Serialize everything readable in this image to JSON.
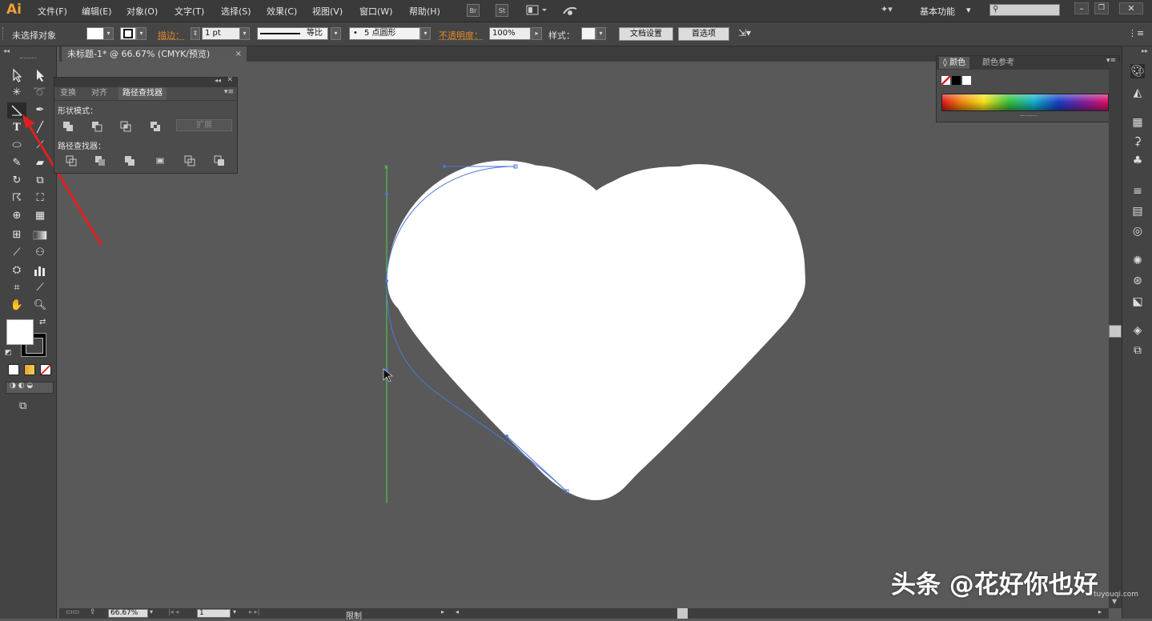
{
  "app": {
    "logo": "Ai"
  },
  "menu": {
    "items": [
      "文件(F)",
      "编辑(E)",
      "对象(O)",
      "文字(T)",
      "选择(S)",
      "效果(C)",
      "视图(V)",
      "窗口(W)",
      "帮助(H)"
    ],
    "bridge_label": "Br",
    "stock_label": "St",
    "workspace": "基本功能",
    "search_placeholder": ""
  },
  "control_bar": {
    "selection_status": "未选择对象",
    "stroke_label": "描边：",
    "stroke_weight": "1 pt",
    "stroke_profile": "等比",
    "brush": "5 点圆形",
    "opacity_label": "不透明度：",
    "opacity_value": "100%",
    "style_label": "样式：",
    "doc_setup_button": "文档设置",
    "preferences_button": "首选项"
  },
  "document": {
    "tab_title": "未标题-1* @ 66.67% (CMYK/预览)",
    "tab_close": "×"
  },
  "pathfinder_panel": {
    "tabs": [
      "变换",
      "对齐",
      "路径查找器"
    ],
    "active_tab": "路径查找器",
    "shape_modes_label": "形状模式：",
    "pathfinders_label": "路径查找器：",
    "expand_button": "扩展"
  },
  "color_panel": {
    "tabs": [
      "颜色",
      "颜色参考"
    ],
    "active_tab": "颜色"
  },
  "status_bar": {
    "zoom": "66.67%",
    "artboard_number": "1",
    "status_text": "限制"
  },
  "watermark": {
    "main": "头条 @花好你也好",
    "sub": "tuyouqi.com"
  },
  "colors": {
    "fill_swatch": "#ffffff",
    "stroke_swatch": "#000000",
    "accent_orange": "#e08a2a",
    "guide_green": "#4fd24f",
    "path_blue": "#4a78d8",
    "arrow_red": "#e02020"
  },
  "icons": {
    "tools": [
      "selection-tool",
      "direct-selection-tool",
      "magic-wand-tool",
      "lasso-tool",
      "line-segment-tool",
      "pen-tool",
      "type-tool",
      "line-tool",
      "ellipse-tool",
      "brush-tool",
      "pencil-tool",
      "eraser-tool",
      "rotate-tool",
      "scale-tool",
      "warp-tool",
      "free-transform-tool",
      "shape-builder-tool",
      "perspective-tool",
      "mesh-tool",
      "gradient-tool",
      "eyedropper-tool",
      "blend-tool",
      "symbol-sprayer-tool",
      "column-graph-tool",
      "artboard-tool",
      "slice-tool",
      "hand-tool",
      "zoom-tool"
    ]
  }
}
